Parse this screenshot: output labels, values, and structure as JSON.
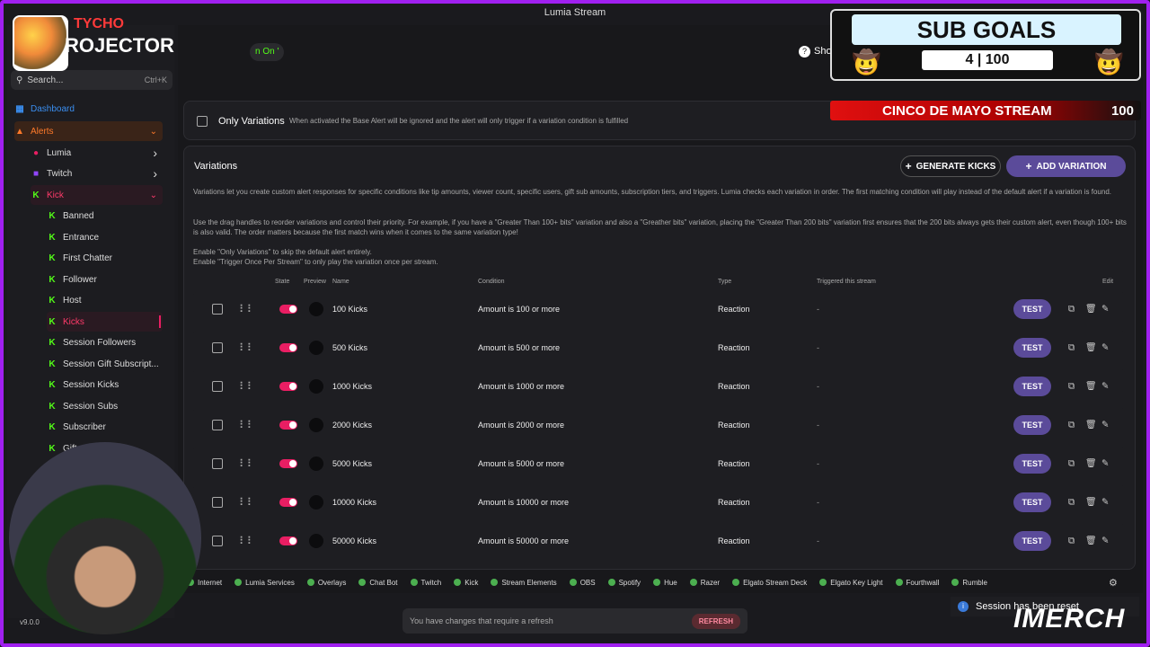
{
  "app": {
    "title": "Lumia Stream",
    "version": "v9.0.0"
  },
  "branding": {
    "line1": "TYCHO",
    "line2": "ROJECTOR"
  },
  "search": {
    "placeholder": "Search...",
    "shortcut": "Ctrl+K"
  },
  "header": {
    "left_text": "n On '",
    "right_text": "Sho"
  },
  "sidebar": {
    "items": [
      {
        "label": "Dashboard",
        "icon": "grid-icon"
      },
      {
        "label": "Alerts",
        "icon": "bell-icon"
      },
      {
        "label": "Lumia",
        "icon": "pin-icon"
      },
      {
        "label": "Twitch",
        "icon": "twitch-icon"
      },
      {
        "label": "Kick",
        "icon": "kick-icon"
      },
      {
        "label": "Banned"
      },
      {
        "label": "Entrance"
      },
      {
        "label": "First Chatter"
      },
      {
        "label": "Follower"
      },
      {
        "label": "Host"
      },
      {
        "label": "Kicks"
      },
      {
        "label": "Session Followers"
      },
      {
        "label": "Session Gift Subscript..."
      },
      {
        "label": "Session Kicks"
      },
      {
        "label": "Session Subs"
      },
      {
        "label": "Subscriber"
      },
      {
        "label": "Gift"
      }
    ]
  },
  "only_variations": {
    "label": "Only Variations",
    "desc": "When activated the Base Alert will be ignored and the alert will only trigger if a variation condition is fulfilled"
  },
  "variations": {
    "title": "Variations",
    "generate_label": "GENERATE KICKS",
    "add_label": "ADD VARIATION",
    "desc1": "Variations let you create custom alert responses for specific conditions like tip amounts, viewer count, specific users, gift sub amounts, subscription tiers, and triggers. Lumia checks each variation in order. The first matching condition will play instead of the default alert if a variation is found.",
    "desc2": "Use the drag handles to reorder variations and control their priority. For example, if you have a \"Greater Than 100+ bits\" variation and also a \"Greather bits\" variation, placing the \"Greater Than 200 bits\" variation first ensures that the 200 bits always gets their custom alert, even though 100+ bits is also valid. The order matters because the first match wins when it comes to the same variation type!",
    "desc3": "Enable \"Only Variations\" to skip the default alert entirely.",
    "desc4": "Enable \"Trigger Once Per Stream\" to only play the variation once per stream.",
    "headers": {
      "state": "State",
      "preview": "Preview",
      "name": "Name",
      "condition": "Condition",
      "type": "Type",
      "triggered": "Triggered this stream",
      "edit": "Edit"
    },
    "rows": [
      {
        "name": "100 Kicks",
        "condition": "Amount is 100 or more",
        "type": "Reaction",
        "triggered": "-",
        "test": "TEST"
      },
      {
        "name": "500 Kicks",
        "condition": "Amount is 500 or more",
        "type": "Reaction",
        "triggered": "-",
        "test": "TEST"
      },
      {
        "name": "1000 Kicks",
        "condition": "Amount is 1000 or more",
        "type": "Reaction",
        "triggered": "-",
        "test": "TEST"
      },
      {
        "name": "2000 Kicks",
        "condition": "Amount is 2000 or more",
        "type": "Reaction",
        "triggered": "-",
        "test": "TEST"
      },
      {
        "name": "5000 Kicks",
        "condition": "Amount is 5000 or more",
        "type": "Reaction",
        "triggered": "-",
        "test": "TEST"
      },
      {
        "name": "10000 Kicks",
        "condition": "Amount is 10000 or more",
        "type": "Reaction",
        "triggered": "-",
        "test": "TEST"
      },
      {
        "name": "50000 Kicks",
        "condition": "Amount is 50000 or more",
        "type": "Reaction",
        "triggered": "-",
        "test": "TEST"
      }
    ]
  },
  "status": [
    "Internet",
    "Lumia Services",
    "Overlays",
    "Chat Bot",
    "Twitch",
    "Kick",
    "Stream Elements",
    "OBS",
    "Spotify",
    "Hue",
    "Razer",
    "Elgato Stream Deck",
    "Elgato Key Light",
    "Fourthwall",
    "Rumble"
  ],
  "refresh": {
    "message": "You have changes that require a refresh",
    "button": "REFRESH"
  },
  "overlay": {
    "sub_goals_title": "SUB GOALS",
    "sub_current": "4",
    "sub_target": "100",
    "stream_label": "CINCO DE MAYO STREAM",
    "stream_value": "100",
    "toast": "Session has been reset",
    "merch": "IMERCH"
  },
  "colors": {
    "accent": "#e91e63",
    "kick": "#53fc18",
    "test_button": "#5b4b9a",
    "frame": "#a020f0"
  }
}
